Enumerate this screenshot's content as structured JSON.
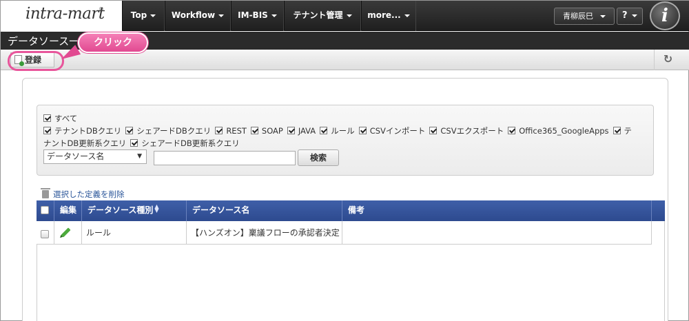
{
  "header": {
    "logo_text": "intra-mart",
    "logo_reg": "®",
    "nav": [
      "Top",
      "Workflow",
      "IM-BIS",
      "テナント管理",
      "more..."
    ],
    "user_name": "青柳辰巳",
    "help_label": "?",
    "avatar_letter": "i"
  },
  "page": {
    "title": "データソース一",
    "register_label": "登録",
    "refresh_icon": "refresh-icon"
  },
  "annotation": {
    "label": "クリック",
    "color": "#e14a91"
  },
  "filters": {
    "all_label": "すべて",
    "row1": [
      "テナントDBクエリ",
      "シェアードDBクエリ",
      "REST",
      "SOAP",
      "JAVA",
      "ルール",
      "CSVインポート",
      "CSVエクスポート",
      "Office365_GoogleApps",
      "テ"
    ],
    "row2": [
      "ナントDB更新系クエリ",
      "シェアードDB更新系クエリ"
    ],
    "select_value": "データソース名",
    "search_value": "",
    "search_button": "検索"
  },
  "actions": {
    "delete_selected": "選択した定義を削除"
  },
  "table": {
    "headers": [
      "編集",
      "データソース種別",
      "データソース名",
      "備考"
    ],
    "rows": [
      {
        "type": "ルール",
        "name": "【ハンズオン】稟議フローの承認者決定",
        "note": ""
      }
    ]
  },
  "colors": {
    "table_header": "#2d4a8f",
    "nav_bg": "#1f1f1f",
    "accent": "#e14a91"
  }
}
